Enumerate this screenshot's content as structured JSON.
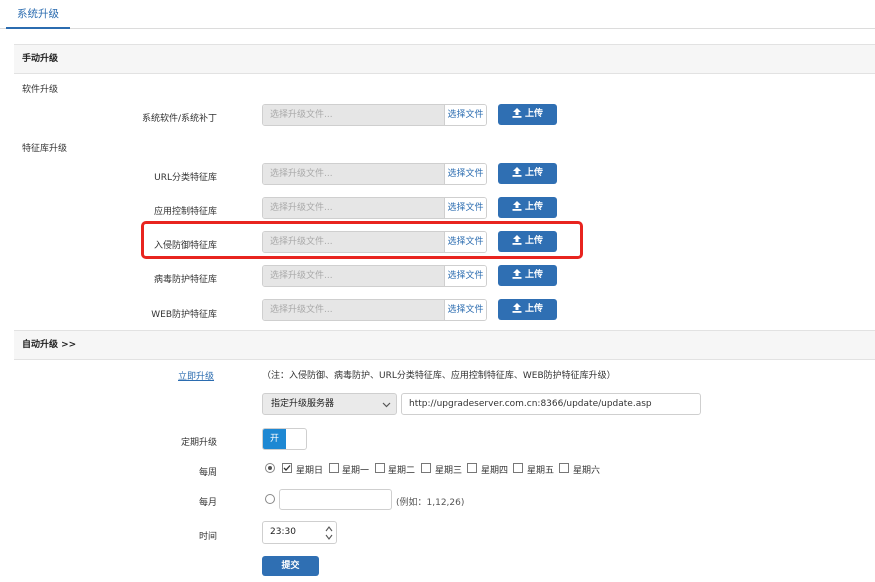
{
  "tabs": [
    {
      "label": "系统升级",
      "active": true
    }
  ],
  "manual": {
    "title": "手动升级",
    "software_group": "软件升级",
    "signature_group": "特征库升级",
    "file_placeholder": "选择升级文件...",
    "choose_file_label": "选择文件",
    "upload_label": "上传",
    "rows": [
      {
        "label": "系统软件/系统补丁"
      },
      {
        "label": "URL分类特征库"
      },
      {
        "label": "应用控制特征库"
      },
      {
        "label": "入侵防御特征库"
      },
      {
        "label": "病毒防护特征库"
      },
      {
        "label": "WEB防护特征库"
      }
    ]
  },
  "auto": {
    "title": "自动升级 >>",
    "upgrade_now_link": "立即升级",
    "note": "（注：入侵防御、病毒防护、URL分类特征库、应用控制特征库、WEB防护特征库升级）",
    "server_select": "指定升级服务器",
    "server_url": "http://upgradeserver.com.cn:8366/update/update.asp",
    "schedule_label": "定期升级",
    "toggle_on_label": "开",
    "toggle_state": "on",
    "weekly_label": "每周",
    "weekdays": [
      {
        "label": "星期日",
        "checked": true
      },
      {
        "label": "星期一",
        "checked": false
      },
      {
        "label": "星期二",
        "checked": false
      },
      {
        "label": "星期三",
        "checked": false
      },
      {
        "label": "星期四",
        "checked": false
      },
      {
        "label": "星期五",
        "checked": false
      },
      {
        "label": "星期六",
        "checked": false
      }
    ],
    "monthly_label": "每月",
    "monthly_example": "(例如：1,12,26)",
    "monthly_value": "",
    "time_label": "时间",
    "time_value": "23:30",
    "submit_label": "提交"
  },
  "colors": {
    "accent": "#2f6fb3",
    "highlight": "#e8241f",
    "toggle_on": "#1e88d3"
  }
}
